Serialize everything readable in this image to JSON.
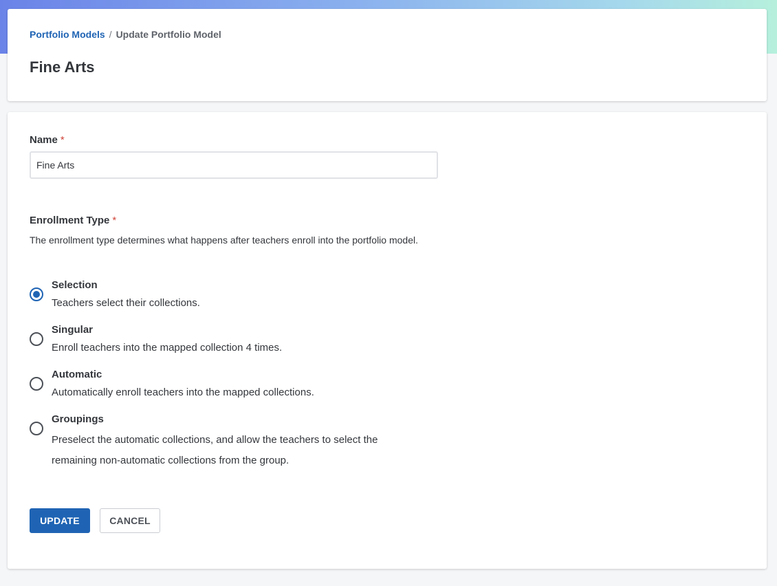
{
  "breadcrumb": {
    "parent": "Portfolio Models",
    "separator": "/",
    "current": "Update Portfolio Model"
  },
  "page": {
    "title": "Fine Arts"
  },
  "form": {
    "name": {
      "label": "Name",
      "required_mark": "*",
      "value": "Fine Arts"
    },
    "enrollment": {
      "label": "Enrollment Type",
      "required_mark": "*",
      "description": "The enrollment type determines what happens after teachers enroll into the portfolio model.",
      "selected": "Selection",
      "options": [
        {
          "title": "Selection",
          "description": "Teachers select their collections."
        },
        {
          "title": "Singular",
          "description": "Enroll teachers into the mapped collection 4 times."
        },
        {
          "title": "Automatic",
          "description": "Automatically enroll teachers into the mapped collections."
        },
        {
          "title": "Groupings",
          "description": "Preselect the automatic collections, and allow the teachers to select the remaining non-automatic collections from the group."
        }
      ]
    },
    "buttons": {
      "update": "UPDATE",
      "cancel": "CANCEL"
    }
  },
  "colors": {
    "primary": "#1f64b4",
    "required": "#d0453b",
    "text": "#33363b"
  }
}
